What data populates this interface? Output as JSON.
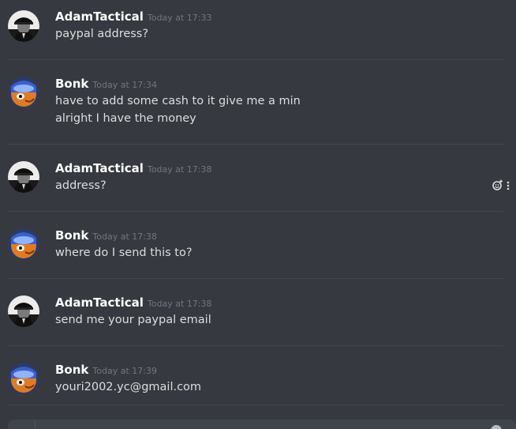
{
  "messages": [
    {
      "author": "AdamTactical",
      "timestamp": "Today at 17:33",
      "avatar": "man-in-cap-avatar",
      "lines": [
        "paypal address?"
      ]
    },
    {
      "author": "Bonk",
      "timestamp": "Today at 17:34",
      "avatar": "orange-cartoon-avatar",
      "lines": [
        "have to add some cash to it give me a min",
        "alright I have the money"
      ]
    },
    {
      "author": "AdamTactical",
      "timestamp": "Today at 17:38",
      "avatar": "man-in-cap-avatar",
      "lines": [
        "address?"
      ]
    },
    {
      "author": "Bonk",
      "timestamp": "Today at 17:38",
      "avatar": "orange-cartoon-avatar",
      "lines": [
        "where do I send this to?"
      ]
    },
    {
      "author": "AdamTactical",
      "timestamp": "Today at 17:38",
      "avatar": "man-in-cap-avatar",
      "lines": [
        "send me your paypal email"
      ]
    },
    {
      "author": "Bonk",
      "timestamp": "Today at 17:39",
      "avatar": "orange-cartoon-avatar",
      "lines": [
        "youri2002.yc@gmail.com"
      ]
    }
  ],
  "hover_actions": {
    "icons": [
      "add-reaction-icon",
      "more-options-icon"
    ]
  },
  "colors": {
    "background": "#36393f",
    "author": "#ffffff",
    "text": "#dcddde",
    "timestamp": "#72767d",
    "divider": "#42454a"
  }
}
